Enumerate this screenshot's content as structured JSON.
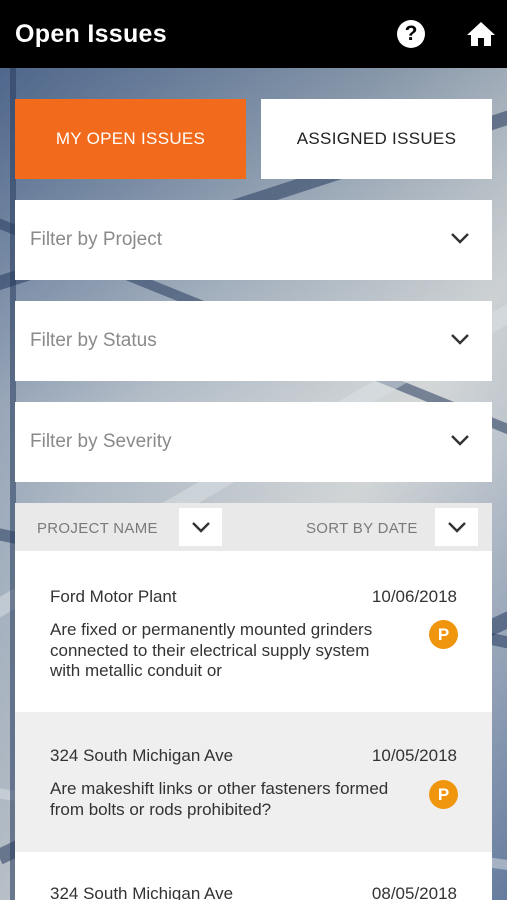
{
  "header": {
    "title": "Open Issues",
    "help_icon": "question-circle-icon",
    "home_icon": "home-icon"
  },
  "tabs": [
    {
      "label": "MY OPEN ISSUES",
      "active": true
    },
    {
      "label": "ASSIGNED ISSUES",
      "active": false
    }
  ],
  "filters": [
    {
      "placeholder": "Filter by Project"
    },
    {
      "placeholder": "Filter by Status"
    },
    {
      "placeholder": "Filter by Severity"
    }
  ],
  "sort": {
    "project_label": "PROJECT NAME",
    "date_label": "SORT BY DATE"
  },
  "issues": [
    {
      "project": "Ford Motor Plant",
      "date": "10/06/2018",
      "description": "Are fixed or permanently mounted grinders connected to their electrical supply system with metallic conduit or",
      "badge": "P"
    },
    {
      "project": "324 South Michigan Ave",
      "date": "10/05/2018",
      "description": "Are makeshift links or other fasteners formed from bolts or rods prohibited?",
      "badge": "P"
    },
    {
      "project": "324 South Michigan Ave",
      "date": "08/05/2018",
      "description": "",
      "badge": ""
    }
  ],
  "colors": {
    "accent": "#f26a1b",
    "badge": "#f0960e",
    "topbar": "#000000"
  }
}
